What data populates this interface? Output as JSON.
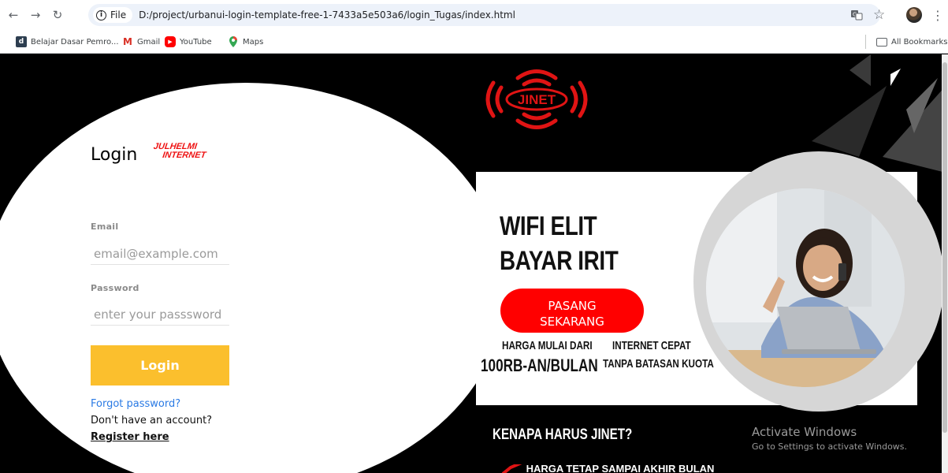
{
  "browser": {
    "url_chip": "File",
    "url": "D:/project/urbanui-login-template-free-1-7433a5e503a6/login_Tugas/index.html",
    "bookmarks": [
      {
        "label": "Belajar Dasar Pemro...",
        "icon": "dicoding-icon"
      },
      {
        "label": "Gmail",
        "icon": "gmail-icon"
      },
      {
        "label": "YouTube",
        "icon": "youtube-icon"
      },
      {
        "label": "Maps",
        "icon": "maps-icon"
      }
    ],
    "all_bookmarks": "All Bookmarks"
  },
  "login": {
    "title": "Login",
    "brand_line1": "JULHELMI",
    "brand_line2": "INTERNET",
    "email_label": "Email",
    "email_placeholder": "email@example.com",
    "password_label": "Password",
    "password_placeholder": "enter your passsword",
    "button": "Login",
    "forgot": "Forgot password?",
    "no_account": "Don't have an account?",
    "register": "Register here"
  },
  "promo": {
    "logo_text": "JINET",
    "headline_line1": "WIFI ELIT",
    "headline_line2": "BAYAR IRIT",
    "cta_line1": "PASANG",
    "cta_line2": "SEKARANG",
    "price_line1": "HARGA MULAI DARI",
    "price_line2": "100RB-AN/BULAN",
    "speed_line1": "INTERNET CEPAT",
    "speed_line2": "TANPA BATASAN KUOTA",
    "why": "KENAPA HARUS JINET?",
    "next_item": "HARGA TETAP SAMPAI AKHIR BULAN"
  },
  "os_overlay": {
    "line1": "Activate Windows",
    "line2": "Go to Settings to activate Windows."
  },
  "colors": {
    "accent_red": "#ff0000",
    "login_button": "#fbbf2d",
    "link_blue": "#2a7ae4",
    "background": "#000000"
  }
}
